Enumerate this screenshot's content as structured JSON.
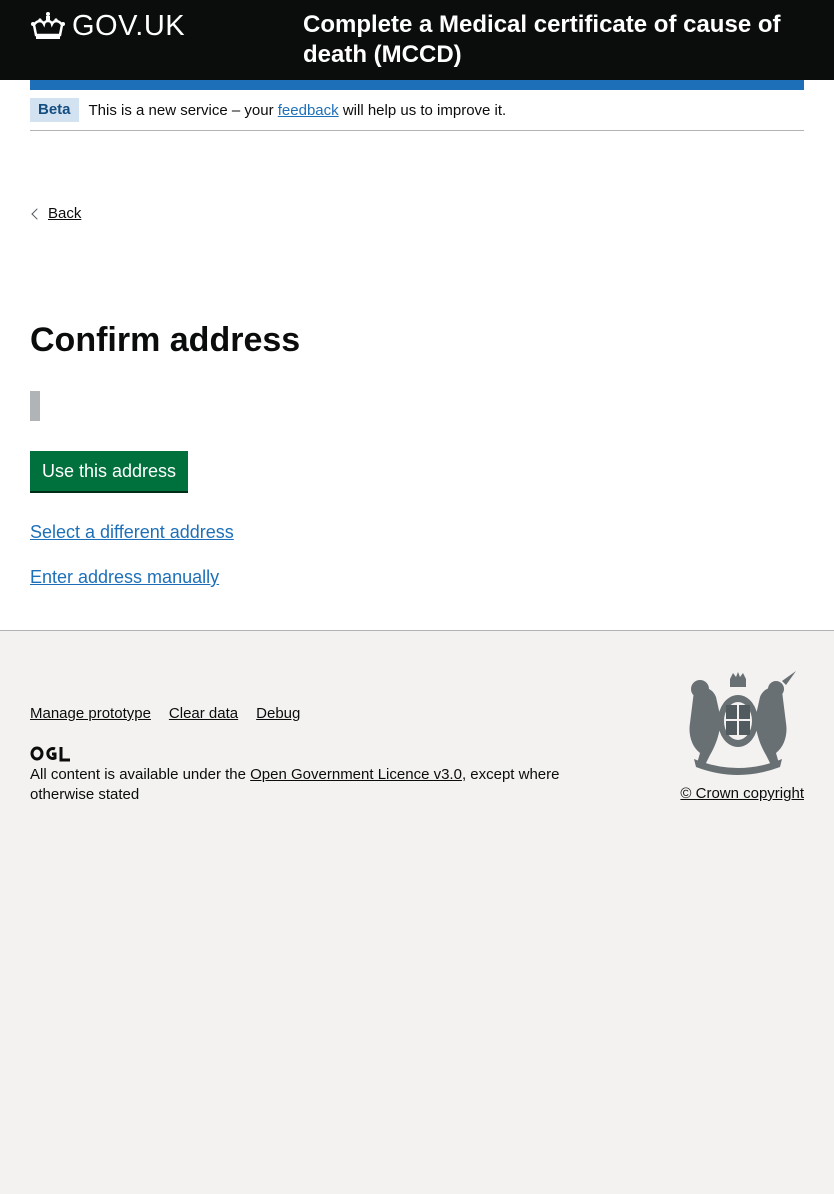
{
  "header": {
    "logo_text": "GOV.UK",
    "service_name": "Complete a Medical certificate of cause of death (MCCD)"
  },
  "phase_banner": {
    "tag": "Beta",
    "text_before": "This is a new service – your ",
    "link": "feedback",
    "text_after": " will help us to improve it."
  },
  "back_link": "Back",
  "main": {
    "title": "Confirm address",
    "primary_button": "Use this address",
    "select_different_link": "Select a different address",
    "enter_manually_link": "Enter address manually"
  },
  "footer": {
    "links": [
      "Manage prototype",
      "Clear data",
      "Debug"
    ],
    "licence_before": "All content is available under the ",
    "licence_link": "Open Government Licence v3.0",
    "licence_after": ", except where otherwise stated",
    "copyright": "© Crown copyright"
  },
  "colors": {
    "header_bg": "#0b0c0c",
    "brand_blue": "#1d70b8",
    "button_green": "#00703c",
    "footer_bg": "#f3f2f1"
  },
  "icons": {
    "crown": "crown-icon",
    "ogl": "ogl-icon",
    "crest": "royal-coat-of-arms-icon",
    "back": "chevron-left-icon"
  }
}
